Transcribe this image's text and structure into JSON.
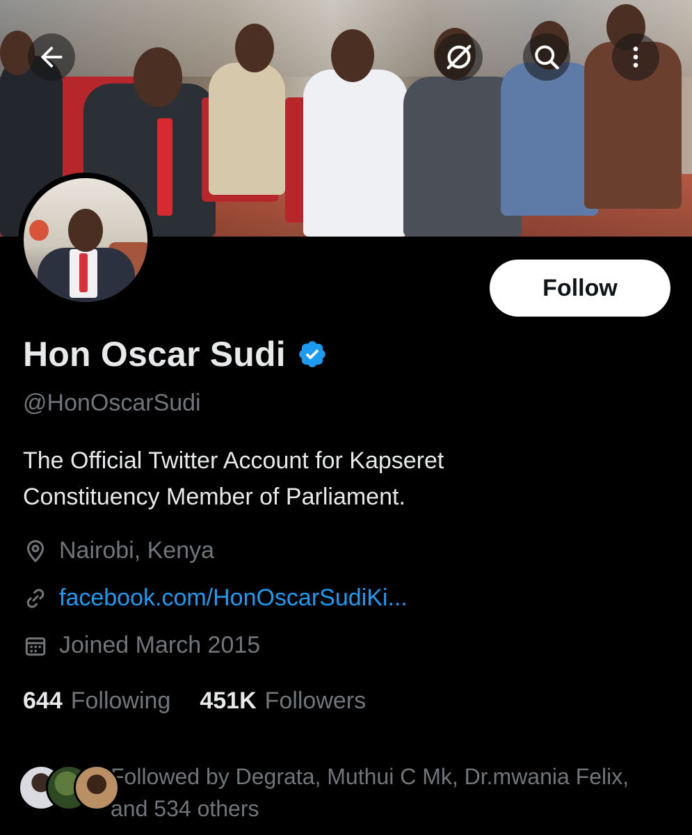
{
  "header": {
    "back_icon": "arrow-left-icon",
    "grok_icon": "grok-icon",
    "search_icon": "search-icon",
    "more_icon": "more-vertical-icon"
  },
  "profile": {
    "display_name": "Hon Oscar Sudi",
    "verified": true,
    "handle": "@HonOscarSudi",
    "bio_lines": [
      "The Official Twitter Account for Kapseret",
      "Constituency Member of Parliament."
    ],
    "location": "Nairobi, Kenya",
    "website": "facebook.com/HonOscarSudiKi...",
    "joined": "Joined March 2015",
    "follow_label": "Follow"
  },
  "stats": {
    "following_count": "644",
    "following_label": "Following",
    "followers_count": "451K",
    "followers_label": "Followers"
  },
  "followed_by": {
    "lines": [
      "Followed by Degrata, Muthui C Mk, Dr.mwania Felix,",
      "and 534 others"
    ]
  },
  "colors": {
    "background": "#000000",
    "text_primary": "#e7e9ea",
    "text_secondary": "#71767b",
    "link": "#1d9bf0",
    "verified_badge": "#1d9bf0"
  }
}
